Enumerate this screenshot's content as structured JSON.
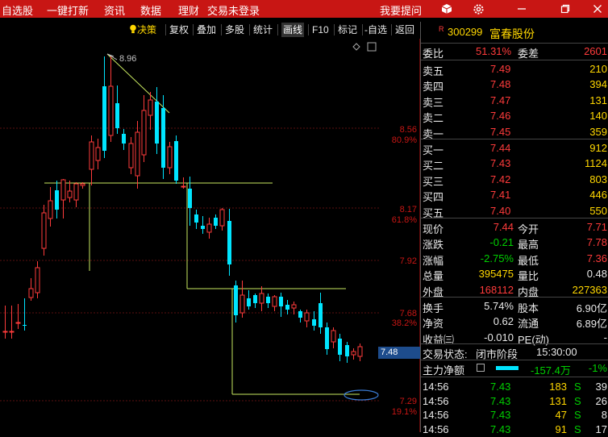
{
  "topbar": {
    "menu": [
      "自选股",
      "一键打新",
      "资讯",
      "数据",
      "理财",
      "交易未登录"
    ],
    "help": "我要提问"
  },
  "toolbar": {
    "items": [
      "决策",
      "复权",
      "叠加",
      "多股",
      "统计",
      "画线",
      "F10",
      "标记",
      "-自选",
      "返回"
    ]
  },
  "chart": {
    "peak_label": "8.96",
    "current_price_tag": "7.48",
    "y_levels": [
      {
        "price": "8.56",
        "pct": "80.9%"
      },
      {
        "price": "8.17",
        "pct": "61.8%"
      },
      {
        "price": "7.92",
        "pct": ""
      },
      {
        "price": "7.68",
        "pct": "38.2%"
      },
      {
        "price": "7.29",
        "pct": "19.1%"
      }
    ]
  },
  "stock": {
    "flag": "R",
    "code": "300299",
    "name": "富春股份"
  },
  "ratio": {
    "label1": "委比",
    "value1": "51.31%",
    "label2": "委差",
    "value2": "2601"
  },
  "asks": [
    {
      "label": "卖五",
      "price": "7.49",
      "vol": "210"
    },
    {
      "label": "卖四",
      "price": "7.48",
      "vol": "394"
    },
    {
      "label": "卖三",
      "price": "7.47",
      "vol": "131"
    },
    {
      "label": "卖二",
      "price": "7.46",
      "vol": "140"
    },
    {
      "label": "卖一",
      "price": "7.45",
      "vol": "359"
    }
  ],
  "bids": [
    {
      "label": "买一",
      "price": "7.44",
      "vol": "912"
    },
    {
      "label": "买二",
      "price": "7.43",
      "vol": "1124"
    },
    {
      "label": "买三",
      "price": "7.42",
      "vol": "803"
    },
    {
      "label": "买四",
      "price": "7.41",
      "vol": "446"
    },
    {
      "label": "买五",
      "price": "7.40",
      "vol": "550"
    }
  ],
  "quote": [
    {
      "l1": "现价",
      "v1": "7.44",
      "l2": "今开",
      "v2": "7.71"
    },
    {
      "l1": "涨跌",
      "v1": "-0.21",
      "l2": "最高",
      "v2": "7.78"
    },
    {
      "l1": "涨幅",
      "v1": "-2.75%",
      "l2": "最低",
      "v2": "7.36"
    },
    {
      "l1": "总量",
      "v1": "395475",
      "l2": "量比",
      "v2": "0.48"
    },
    {
      "l1": "外盘",
      "v1": "168112",
      "l2": "内盘",
      "v2": "227363"
    }
  ],
  "fund": [
    {
      "l1": "换手",
      "v1": "5.74%",
      "l2": "股本",
      "v2": "6.90亿"
    },
    {
      "l1": "净资",
      "v1": "0.62",
      "l2": "流通",
      "v2": "6.89亿"
    },
    {
      "l1": "收益㈢",
      "v1": "-0.010",
      "l2": "PE(动)",
      "v2": "-"
    }
  ],
  "trade_status": {
    "label": "交易状态:",
    "value": "闭市阶段",
    "time": "15:30:00"
  },
  "main_flow": {
    "label": "主力净额",
    "value": "-157.4万",
    "pct": "-1%"
  },
  "ticks": [
    {
      "time": "14:56",
      "price": "7.43",
      "vol": "183",
      "side": "S",
      "n": "39"
    },
    {
      "time": "14:56",
      "price": "7.43",
      "vol": "131",
      "side": "S",
      "n": "26"
    },
    {
      "time": "14:56",
      "price": "7.43",
      "vol": "47",
      "side": "S",
      "n": "8"
    },
    {
      "time": "14:56",
      "price": "7.43",
      "vol": "91",
      "side": "S",
      "n": "17"
    }
  ],
  "colors": {
    "up": "#ff3b3b",
    "down": "#00e5ff",
    "accent": "#c81614",
    "fib": "#c8e860"
  }
}
